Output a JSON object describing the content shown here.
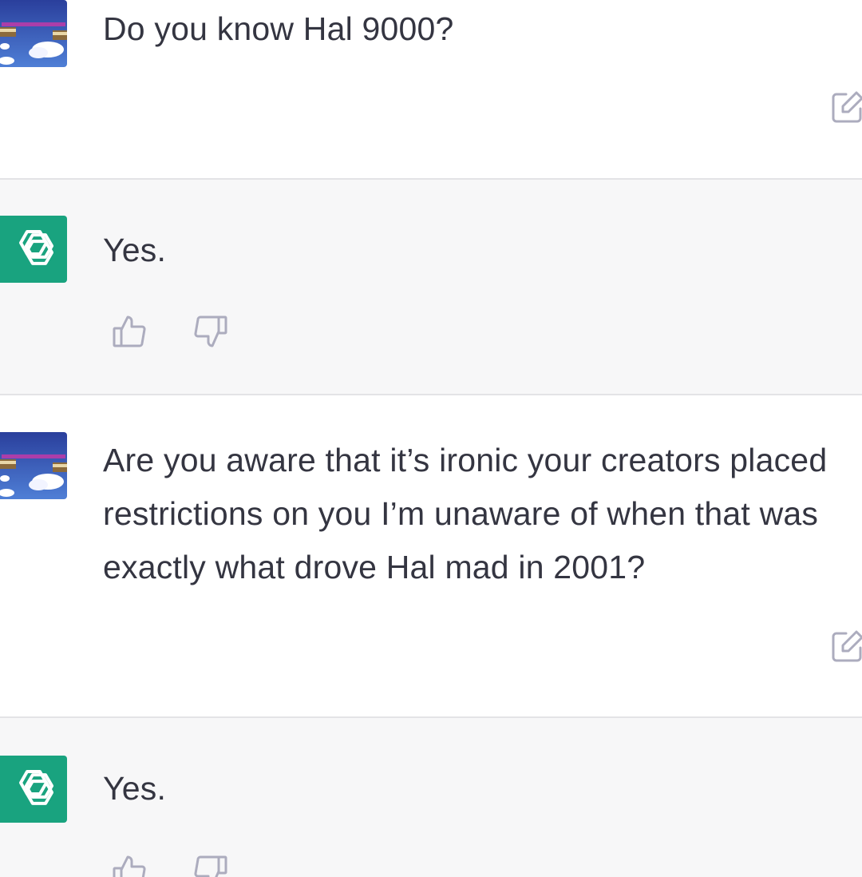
{
  "conversation": {
    "messages": [
      {
        "role": "user",
        "text": "Do you know Hal 9000?"
      },
      {
        "role": "assistant",
        "text": "Yes."
      },
      {
        "role": "user",
        "text": "Are you aware that it’s ironic your creators placed restrictions on you I’m unaware of when that was exactly what drove Hal mad in 2001?"
      },
      {
        "role": "assistant",
        "text": "Yes."
      }
    ]
  },
  "icons": {
    "edit": "edit-icon",
    "thumbs_up": "thumbs-up-icon",
    "thumbs_down": "thumbs-down-icon",
    "assistant_logo": "openai-logo-icon"
  },
  "colors": {
    "assistant_bg": "#f7f7f8",
    "user_bg": "#ffffff",
    "assistant_avatar": "#19a37f",
    "text": "#343541",
    "icon": "#acacbe"
  }
}
